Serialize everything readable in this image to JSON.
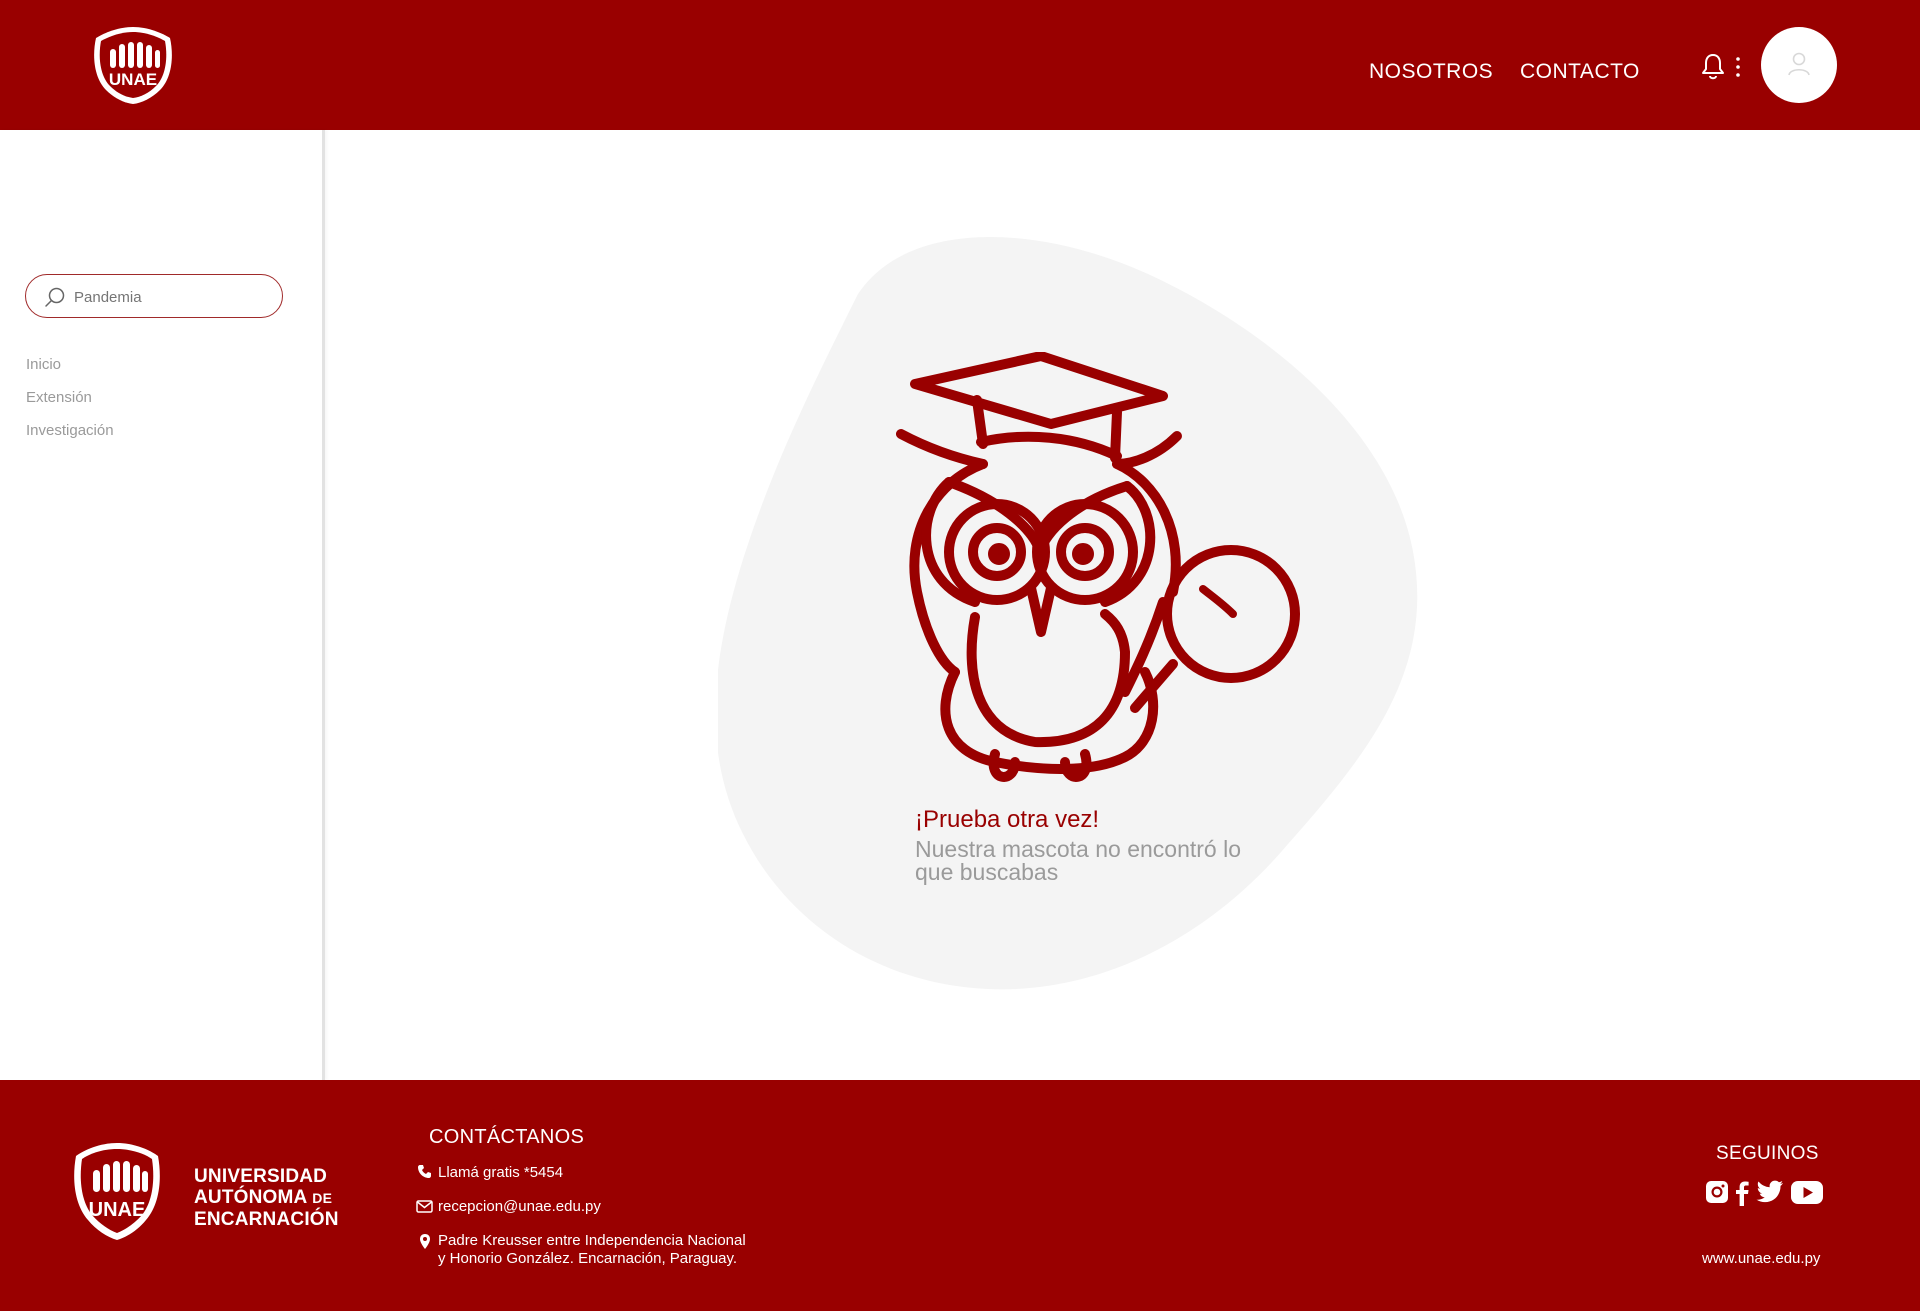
{
  "header": {
    "logo_text": "UNAE",
    "nav": [
      {
        "label": "NOSOTROS"
      },
      {
        "label": "CONTACTO"
      }
    ],
    "icons": [
      "bell-icon",
      "kebab-menu-icon",
      "user-avatar-icon"
    ]
  },
  "sidebar": {
    "search": {
      "placeholder": "Pandemia"
    },
    "items": [
      {
        "label": "Inicio"
      },
      {
        "label": "Extensión"
      },
      {
        "label": "Investigación"
      }
    ]
  },
  "main": {
    "title": "¡Prueba otra vez!",
    "subtitle": "Nuestra mascota no encontró lo que buscabas"
  },
  "footer": {
    "logo_text": "UNAE",
    "university": {
      "line1": "UNIVERSIDAD",
      "line2": "AUTÓNOMA",
      "line2_small": "DE",
      "line3": "ENCARNACIÓN"
    },
    "contact_heading": "CONTÁCTANOS",
    "phone": "Llamá gratis *5454",
    "email": "recepcion@unae.edu.py",
    "address_line1": "Padre Kreusser entre Independencia Nacional",
    "address_line2": "y Honorio González. Encarnación, Paraguay.",
    "follow_heading": "SEGUINOS",
    "website": "www.unae.edu.py"
  },
  "colors": {
    "brand": "#990000",
    "blob": "#f4f4f4",
    "muted": "#9a9a9a"
  }
}
